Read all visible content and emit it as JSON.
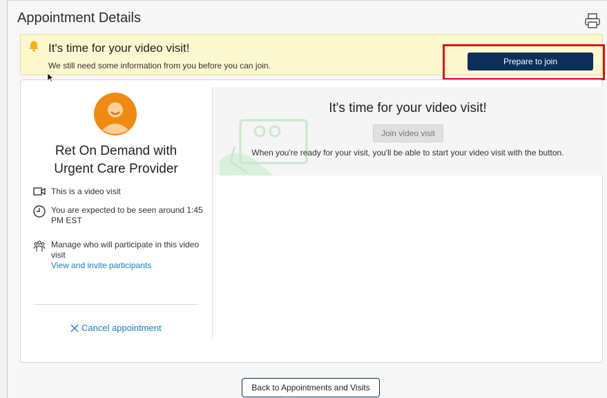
{
  "header": {
    "title": "Appointment Details",
    "print_icon": "printer-icon"
  },
  "banner": {
    "icon": "bell-icon",
    "title": "It's time for your video visit!",
    "subtitle": "We still need some information from you before you can join.",
    "join_button": "Prepare to join"
  },
  "provider": {
    "avatar_icon": "avatar-icon",
    "name": "Ret On Demand with Urgent Care Provider"
  },
  "details": {
    "video_visit": "This is a video visit",
    "expected_time": "You are expected to be seen around 1:45 PM EST",
    "participants_text": "Manage who will participate in this video visit",
    "participants_link": "View and invite participants",
    "cancel_label": "Cancel appointment"
  },
  "visit_panel": {
    "title": "It's time for your video visit!",
    "join_button": "Join video visit",
    "subtitle": "When you're ready for your visit, you'll be able to start your video visit with the button."
  },
  "footer": {
    "back_button": "Back to Appointments and Visits"
  },
  "colors": {
    "banner_bg": "#fbf8cf",
    "primary_button": "#0d2f5a",
    "highlight": "#e00d0d",
    "link": "#1a7fb8",
    "avatar": "#f08a12"
  }
}
